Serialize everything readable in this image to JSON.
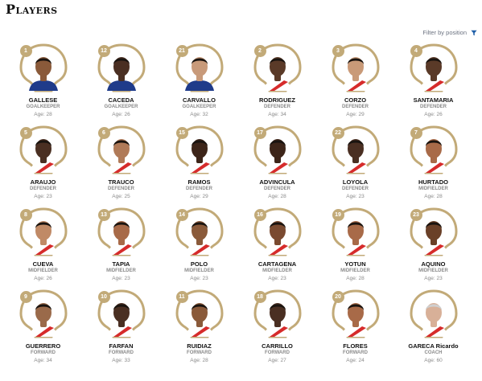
{
  "header": {
    "title": "Players"
  },
  "filter": {
    "label": "Filter by position",
    "icon": "funnel-icon",
    "icon_color": "#1f5fa8"
  },
  "colors": {
    "frame_gold": "#c2aa78",
    "frame_gold_light": "#ddd0ae"
  },
  "age_prefix": "Age:",
  "players": [
    {
      "number": "1",
      "name": "GALLESE",
      "position": "GOALKEEPER",
      "age": "28",
      "jersey": "#1f3b8a",
      "skin": "#8a5a3a"
    },
    {
      "number": "12",
      "name": "CACEDA",
      "position": "GOALKEEPER",
      "age": "26",
      "jersey": "#1f3b8a",
      "skin": "#4a2f22"
    },
    {
      "number": "21",
      "name": "CARVALLO",
      "position": "GOALKEEPER",
      "age": "32",
      "jersey": "#1f3b8a",
      "skin": "#c89a7a"
    },
    {
      "number": "2",
      "name": "RODRIGUEZ",
      "position": "DEFENDER",
      "age": "34",
      "jersey": "#ffffff",
      "skin": "#5a3a28"
    },
    {
      "number": "3",
      "name": "CORZO",
      "position": "DEFENDER",
      "age": "29",
      "jersey": "#ffffff",
      "skin": "#c99a78"
    },
    {
      "number": "4",
      "name": "SANTAMARIA",
      "position": "DEFENDER",
      "age": "26",
      "jersey": "#ffffff",
      "skin": "#5a3a28"
    },
    {
      "number": "5",
      "name": "ARAUJO",
      "position": "DEFENDER",
      "age": "23",
      "jersey": "#ffffff",
      "skin": "#4a2f22"
    },
    {
      "number": "6",
      "name": "TRAUCO",
      "position": "DEFENDER",
      "age": "25",
      "jersey": "#ffffff",
      "skin": "#b07a58"
    },
    {
      "number": "15",
      "name": "RAMOS",
      "position": "DEFENDER",
      "age": "29",
      "jersey": "#ffffff",
      "skin": "#3d2519"
    },
    {
      "number": "17",
      "name": "ADVINCULA",
      "position": "DEFENDER",
      "age": "28",
      "jersey": "#ffffff",
      "skin": "#3d2519"
    },
    {
      "number": "22",
      "name": "LOYOLA",
      "position": "DEFENDER",
      "age": "23",
      "jersey": "#ffffff",
      "skin": "#4a2f22"
    },
    {
      "number": "7",
      "name": "HURTADO",
      "position": "MIDFIELDER",
      "age": "28",
      "jersey": "#ffffff",
      "skin": "#a86a48"
    },
    {
      "number": "8",
      "name": "CUEVA",
      "position": "MIDFIELDER",
      "age": "26",
      "jersey": "#ffffff",
      "skin": "#c08a66"
    },
    {
      "number": "13",
      "name": "TAPIA",
      "position": "MIDFIELDER",
      "age": "23",
      "jersey": "#ffffff",
      "skin": "#a86a48"
    },
    {
      "number": "14",
      "name": "POLO",
      "position": "MIDFIELDER",
      "age": "23",
      "jersey": "#ffffff",
      "skin": "#8a5a3a"
    },
    {
      "number": "16",
      "name": "CARTAGENA",
      "position": "MIDFIELDER",
      "age": "23",
      "jersey": "#ffffff",
      "skin": "#7a4a30"
    },
    {
      "number": "19",
      "name": "YOTUN",
      "position": "MIDFIELDER",
      "age": "28",
      "jersey": "#ffffff",
      "skin": "#a86a48"
    },
    {
      "number": "23",
      "name": "AQUINO",
      "position": "MIDFIELDER",
      "age": "23",
      "jersey": "#ffffff",
      "skin": "#6a4028"
    },
    {
      "number": "9",
      "name": "GUERRERO",
      "position": "FORWARD",
      "age": "34",
      "jersey": "#ffffff",
      "skin": "#9a6a4a"
    },
    {
      "number": "10",
      "name": "FARFAN",
      "position": "FORWARD",
      "age": "33",
      "jersey": "#ffffff",
      "skin": "#4a2f22"
    },
    {
      "number": "11",
      "name": "RUIDIAZ",
      "position": "FORWARD",
      "age": "28",
      "jersey": "#ffffff",
      "skin": "#8a5a3a"
    },
    {
      "number": "18",
      "name": "CARRILLO",
      "position": "FORWARD",
      "age": "27",
      "jersey": "#ffffff",
      "skin": "#4a2f22"
    },
    {
      "number": "20",
      "name": "FLORES",
      "position": "FORWARD",
      "age": "24",
      "jersey": "#ffffff",
      "skin": "#a86a48"
    },
    {
      "number": "",
      "name": "GARECA Ricardo",
      "position": "COACH",
      "age": "60",
      "jersey": "#ffffff",
      "skin": "#d8b098"
    }
  ]
}
